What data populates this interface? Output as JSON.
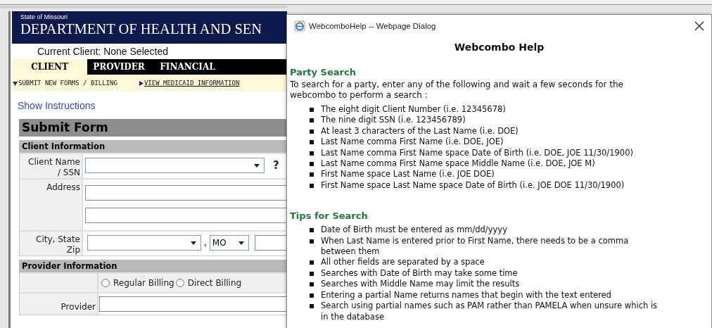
{
  "page": {
    "header": {
      "state": "State of Missouri",
      "department": "DEPARTMENT OF HEALTH AND SEN"
    },
    "current_client": "Current Client: None Selected",
    "tabs": [
      {
        "label": "CLIENT",
        "selected": true
      },
      {
        "label": "PROVIDER",
        "selected": false
      },
      {
        "label": "FINANCIAL",
        "selected": false
      }
    ],
    "subnav": [
      {
        "label": "SUBMIT NEW FORMS / BILLING",
        "expanded": true
      },
      {
        "label": "VIEW MEDICAID INFORMATION",
        "expanded": false
      }
    ],
    "instructions_link": "Show Instructions",
    "form": {
      "title": "Submit Form",
      "sections": [
        {
          "title": "Client Information",
          "rows": [
            {
              "kind": "combo",
              "label": "Client Name / SSN",
              "help": "?"
            },
            {
              "kind": "address",
              "label": "Address"
            },
            {
              "kind": "citystate",
              "label": "City, State Zip",
              "separator": ",",
              "state": "MO"
            }
          ]
        },
        {
          "title": "Provider Information",
          "rows": [
            {
              "kind": "radios",
              "options": [
                {
                  "label": "Regular Billing",
                  "checked": false
                },
                {
                  "label": "Direct Billing",
                  "checked": false
                }
              ]
            },
            {
              "kind": "text",
              "label": "Provider"
            }
          ]
        }
      ]
    }
  },
  "dialog": {
    "title": "WebcomboHelp -- Webpage Dialog",
    "heading": "Webcombo Help",
    "sections": [
      {
        "title": "Party Search",
        "intro": "To search for a party, enter any of the following and wait a few seconds for the webcombo to perform a search :",
        "items": [
          "The eight digit Client Number (i.e. 12345678)",
          "The nine digit SSN (i.e. 123456789)",
          "At least 3 characters of the Last Name (i.e. DOE)",
          "Last Name comma First Name (i.e. DOE, JOE)",
          "Last Name comma First Name space Date of Birth (i.e. DOE, JOE 11/30/1900)",
          "Last Name comma First Name space Middle Name (i.e. DOE, JOE M)",
          "First Name space Last Name (i.e. JOE DOE)",
          "First Name space Last Name space Date of Birth (i.e. JOE DOE 11/30/1900)"
        ]
      },
      {
        "title": "Tips for Search",
        "items": [
          "Date of Birth must be entered as mm/dd/yyyy",
          "When Last Name is entered prior to First Name, there needs to be a comma between them",
          "All other fields are separated by a space",
          "Searches with Date of Birth may take some time",
          "Searches with Middle Name may limit the results",
          "Entering a partial Name returns names that begin with the text entered",
          "Search using partial names such as PAM rather than PAMELA when unsure which is in the database"
        ]
      }
    ]
  }
}
